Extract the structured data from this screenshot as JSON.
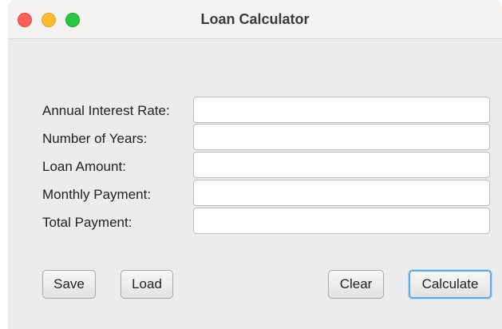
{
  "window": {
    "title": "Loan Calculator"
  },
  "form": {
    "fields": [
      {
        "label": "Annual Interest Rate:",
        "value": "",
        "placeholder": ""
      },
      {
        "label": "Number of Years:",
        "value": "",
        "placeholder": ""
      },
      {
        "label": "Loan Amount:",
        "value": "",
        "placeholder": ""
      },
      {
        "label": "Monthly Payment:",
        "value": "",
        "placeholder": ""
      },
      {
        "label": "Total Payment:",
        "value": "",
        "placeholder": ""
      }
    ]
  },
  "buttons": {
    "save": "Save",
    "load": "Load",
    "clear": "Clear",
    "calculate": "Calculate"
  },
  "colors": {
    "close": "#fe5f57",
    "minimize": "#febc2e",
    "maximize": "#28c840",
    "focus_ring": "#5fa8e6"
  }
}
